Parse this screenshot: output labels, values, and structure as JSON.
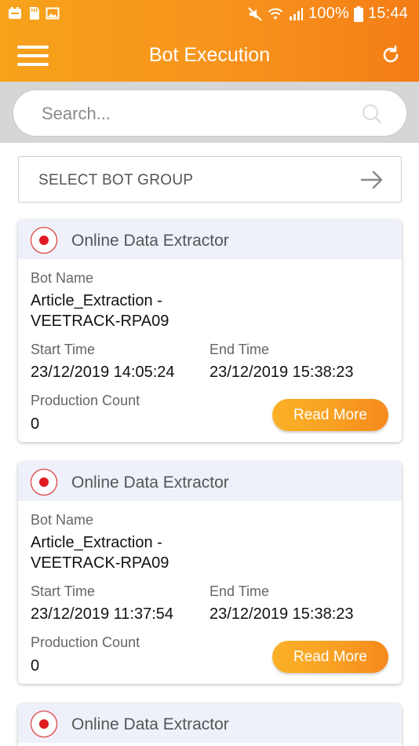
{
  "status_bar": {
    "battery": "100%",
    "time": "15:44"
  },
  "app_bar": {
    "title": "Bot Execution"
  },
  "search": {
    "placeholder": "Search..."
  },
  "select_group": {
    "label": "SELECT BOT GROUP"
  },
  "labels": {
    "bot_name": "Bot Name",
    "start_time": "Start Time",
    "end_time": "End Time",
    "production_count": "Production Count",
    "read_more": "Read More"
  },
  "cards": [
    {
      "title": "Online Data Extractor",
      "bot_name_line1": "Article_Extraction -",
      "bot_name_line2": "VEETRACK-RPA09",
      "start_time": "23/12/2019 14:05:24",
      "end_time": "23/12/2019 15:38:23",
      "production_count": "0"
    },
    {
      "title": "Online Data Extractor",
      "bot_name_line1": "Article_Extraction -",
      "bot_name_line2": "VEETRACK-RPA09",
      "start_time": "23/12/2019 11:37:54",
      "end_time": "23/12/2019 15:38:23",
      "production_count": "0"
    },
    {
      "title": "Online Data Extractor"
    }
  ],
  "colors": {
    "accent": "#f7931c",
    "status_dot": "#e11b22"
  }
}
